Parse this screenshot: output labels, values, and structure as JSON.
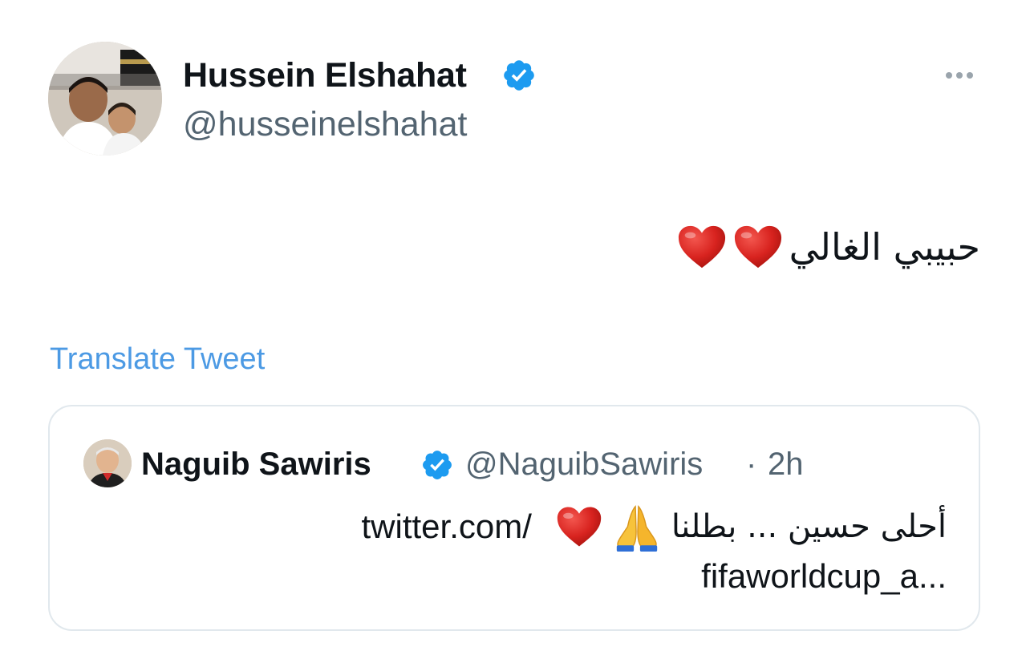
{
  "tweet": {
    "author_name": "Hussein Elshahat",
    "author_handle": "@husseinelshahat",
    "text": "حبيبي الغالي",
    "text_emoji": "heart-icon x2",
    "translate_label": "Translate Tweet"
  },
  "quote": {
    "author_name": "Naguib Sawiris",
    "author_handle": "@NaguibSawiris",
    "separator": "·",
    "time": "2h",
    "text_arabic": "أحلى حسين ... بطلنا",
    "text_link_part1": "twitter.com/",
    "text_link_part2": "fifaworldcup_a..."
  },
  "colors": {
    "verified": "#1d9bf0",
    "link": "#4c9ae4",
    "secondary_text": "#536471",
    "heart": "#d8231f"
  }
}
